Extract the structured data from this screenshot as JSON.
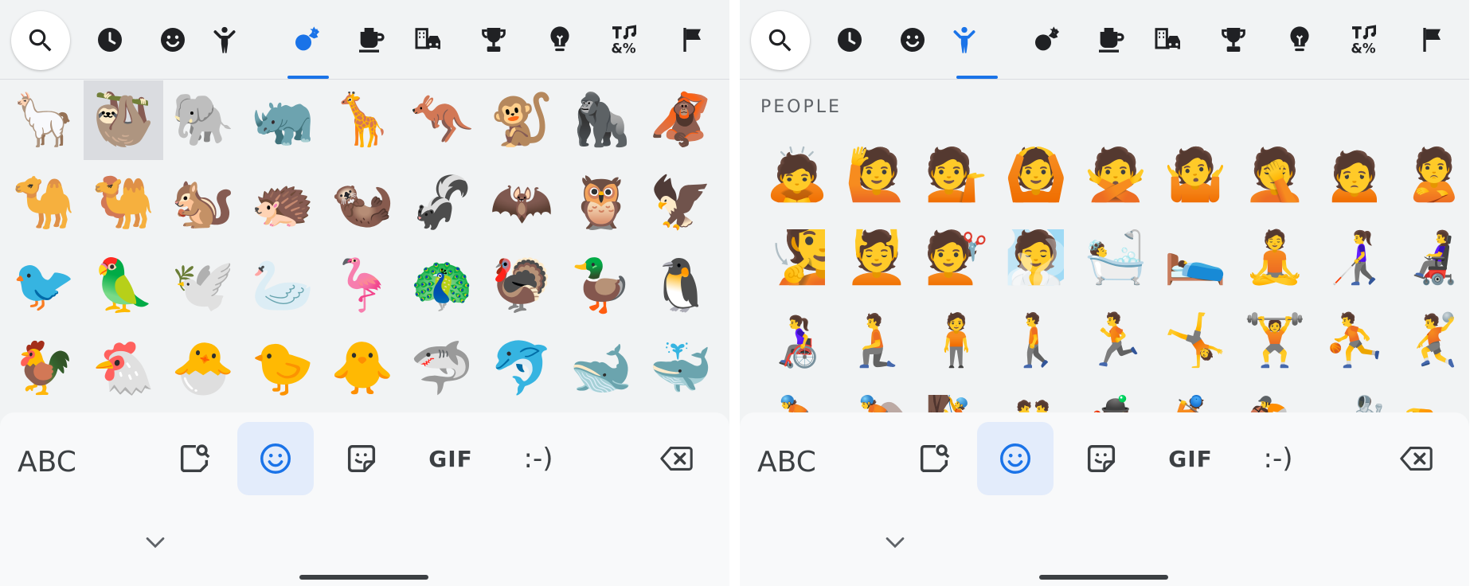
{
  "colors": {
    "accent": "#1a73e8",
    "icon": "#202124",
    "selected_tool_bg": "#e3ecfb",
    "selected_cell_bg": "#dadce0"
  },
  "category_icons": [
    "recent-icon",
    "smileys-icon",
    "people-icon",
    "animals-nature-icon",
    "food-drink-icon",
    "travel-places-icon",
    "activities-icon",
    "objects-icon",
    "symbols-icon",
    "flags-icon"
  ],
  "left": {
    "active_category": "animals-nature",
    "rows": [
      [
        "🦙",
        "🦥",
        "🐘",
        "🦏",
        "🦒",
        "🦘",
        "🐒",
        "🦍",
        "🦧"
      ],
      [
        "🐪",
        "🐫",
        "🐿️",
        "🦔",
        "🦦",
        "🦨",
        "🦇",
        "🦉",
        "🦅"
      ],
      [
        "🐦",
        "🦜",
        "🕊️",
        "🦢",
        "🦩",
        "🦚",
        "🦃",
        "🦆",
        "🐧"
      ],
      [
        "🐓",
        "🐔",
        "🐣",
        "🐤",
        "🐥",
        "🦈",
        "🐬",
        "🐋",
        "🐳"
      ]
    ]
  },
  "right": {
    "active_category": "people",
    "section_label": "PEOPLE",
    "rows": [
      [
        "🙇",
        "🙋",
        "💁",
        "🙆",
        "🙅",
        "🤷",
        "🤦",
        "🙍",
        "🙎"
      ],
      [
        "🧏",
        "💆",
        "💇",
        "🧖",
        "🛀",
        "🛌",
        "🧘",
        "👩‍🦯",
        "👩‍🦼"
      ],
      [
        "👩‍🦽",
        "🧎",
        "🧍",
        "🚶",
        "🏃",
        "🤸",
        "🏋️",
        "⛹️",
        "🤾"
      ],
      [
        "🚴",
        "🚵",
        "🧗",
        "🤼",
        "🤹",
        "🏌️",
        "🏇",
        "🤺",
        "🏊"
      ]
    ]
  },
  "toolbar": {
    "abc_label": "ABC",
    "gif_label": "GIF",
    "emoticon_label": ":-)",
    "active_tool": "emoji"
  }
}
